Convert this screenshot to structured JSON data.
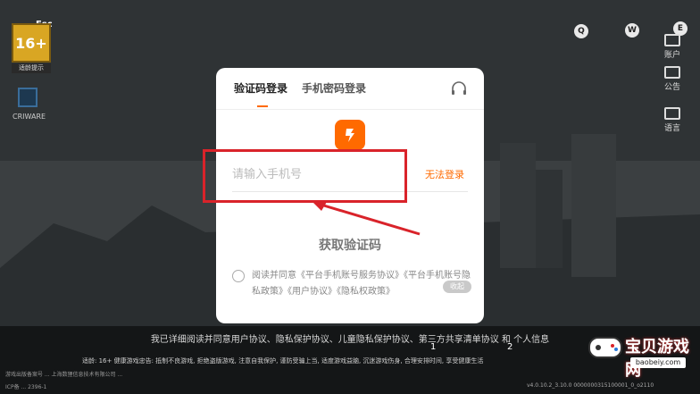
{
  "hotkeys": {
    "esc": "Esc",
    "q": "Q",
    "w": "W",
    "e": "E"
  },
  "sidebar": {
    "age_rating": "16+",
    "age_label": "适龄提示",
    "cri_label": "CRIWARE",
    "notice_label": "账户",
    "bulletin_label": "公告",
    "language_label": "语言"
  },
  "login": {
    "tabs": [
      {
        "label": "验证码登录"
      },
      {
        "label": "手机密码登录"
      }
    ],
    "phone_placeholder": "请输入手机号",
    "cant_login": "无法登录",
    "get_code": "获取验证码",
    "agreement": "阅读并同意《平台手机账号服务协议》《平台手机账号隐私政策》《用户协议》《隐私权政策》",
    "fold": "收起"
  },
  "background": {
    "notice": "我已详细阅读并同意用户协议、隐私保护协议、儿童隐私保护协议、第三方共享清单协议 和 个人信息",
    "num1": "1",
    "num2": "2",
    "health": "适龄: 16+ 健康游戏忠告: 抵制不良游戏, 拒绝盗版游戏, 注意自我保护, 谨防受骗上当, 适度游戏益脑, 沉迷游戏伤身, 合理安排时间, 享受健康生活",
    "footer": "游戏出版备案号 ... 上海数狸信息技术有限公司 ...",
    "footer2": "ICP备 ... 2396-1",
    "version": "v4.0.10.2_3.10.0  0000000315100001_0_o2110"
  },
  "watermark": {
    "text": "宝贝游戏网",
    "url": "baobeiy.com"
  },
  "colors": {
    "accent": "#ff6a00",
    "highlight": "#d9232a"
  }
}
